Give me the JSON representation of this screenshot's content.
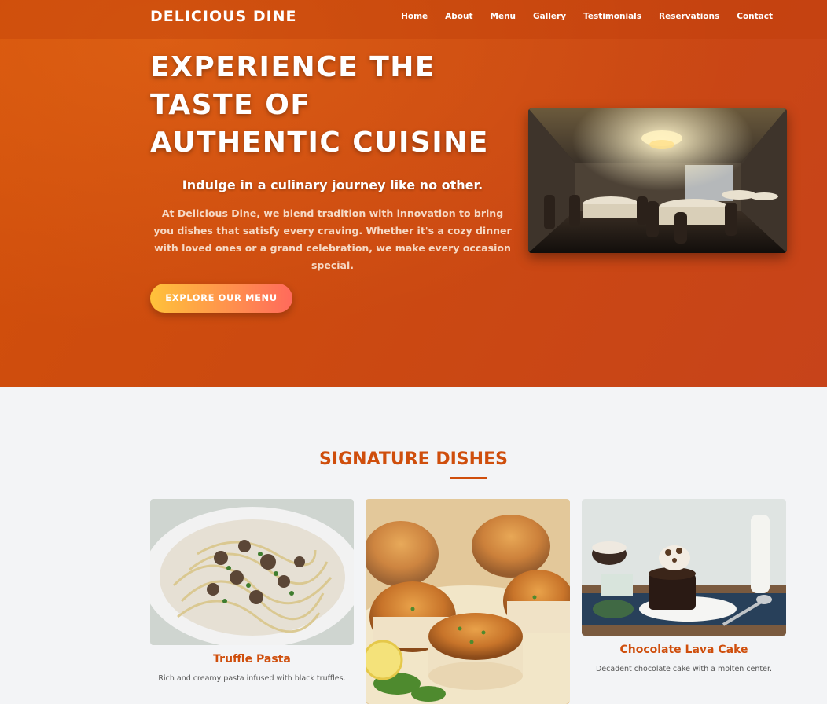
{
  "brand": {
    "name": "DELICIOUS DINE"
  },
  "nav": {
    "items": [
      "Home",
      "About",
      "Menu",
      "Gallery",
      "Testimonials",
      "Reservations",
      "Contact"
    ]
  },
  "hero": {
    "title": "EXPERIENCE THE TASTE OF AUTHENTIC CUISINE",
    "subtitle": "Indulge in a culinary journey like no other.",
    "paragraph": "At Delicious Dine, we blend tradition with innovation to bring you dishes that satisfy every craving. Whether it's a cozy dinner with loved ones or a grand celebration, we make every occasion special.",
    "cta": "EXPLORE OUR MENU",
    "image_alt": "Elegant restaurant dining room with chandelier"
  },
  "signature": {
    "title": "SIGNATURE DISHES",
    "dishes": [
      {
        "name": "Truffle Pasta",
        "description": "Rich and creamy pasta infused with black truffles."
      },
      {
        "name": "",
        "description": ""
      },
      {
        "name": "Chocolate Lava Cake",
        "description": "Decadent chocolate cake with a molten center."
      }
    ]
  },
  "colors": {
    "accent": "#cf4e0c",
    "hero_bg": "#cc4a10",
    "cta_start": "#ffc23a",
    "cta_end": "#ff6a5c"
  }
}
